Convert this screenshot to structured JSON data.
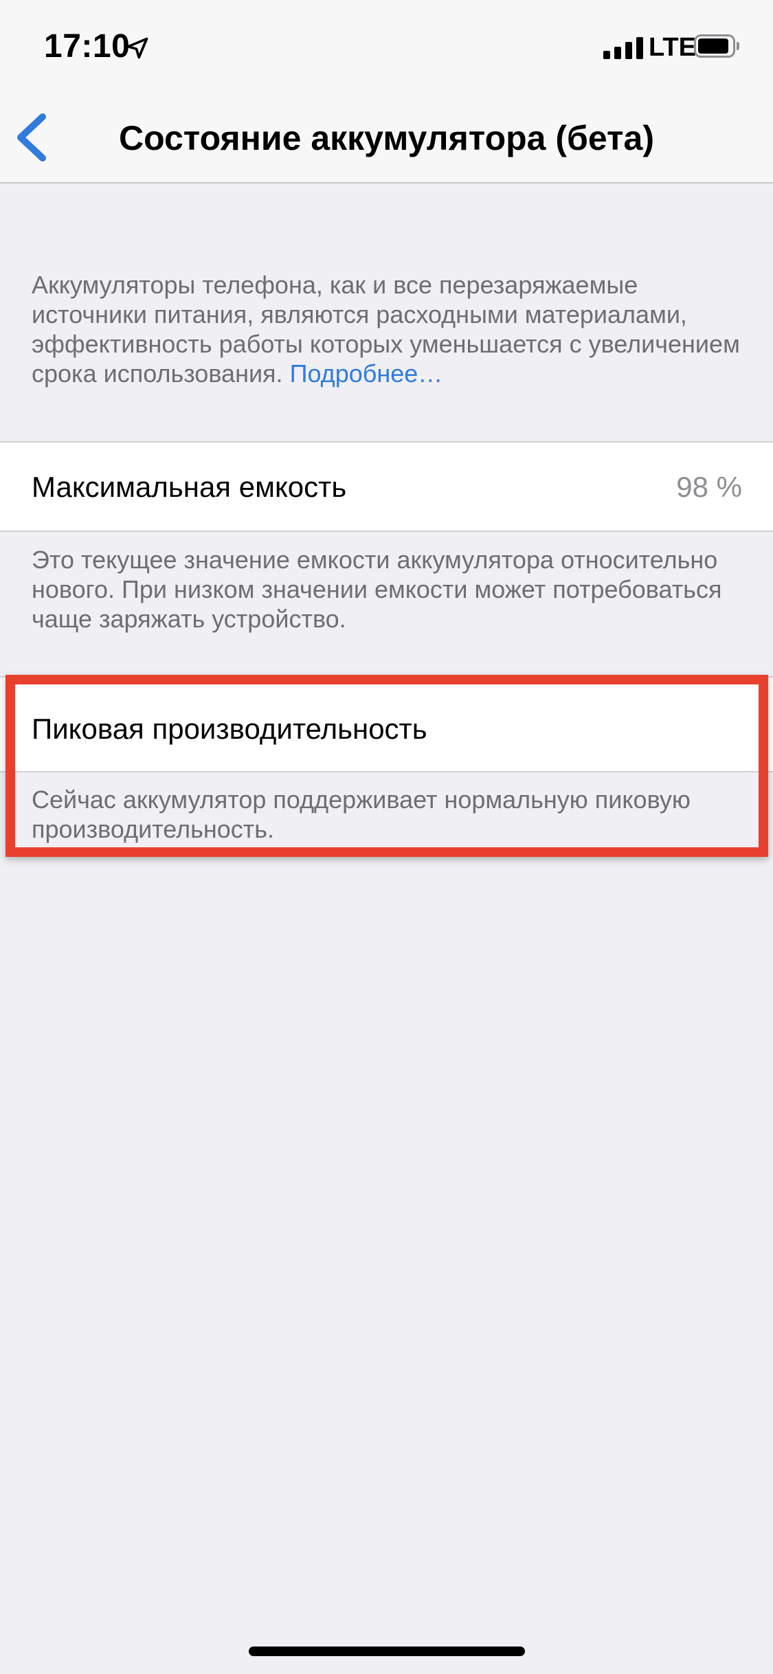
{
  "status_bar": {
    "time": "17:10",
    "network": "LTE",
    "location_icon": "location-arrow-icon",
    "signal_icon": "cellular-signal-icon",
    "battery_icon": "battery-icon"
  },
  "nav": {
    "back_icon": "chevron-left-icon",
    "title": "Состояние аккумулятора (бета)"
  },
  "intro": {
    "text": "Аккумуляторы телефона, как и все перезаряжаемые источники питания, являются расходными материалами, эффективность работы которых уменьшается с увеличением срока использования.",
    "link": "Подробнее…"
  },
  "max_capacity": {
    "label": "Максимальная емкость",
    "value": "98 %",
    "footer": "Это текущее значение емкости аккумулятора относительно нового. При низком значении емкости может потребоваться чаще заряжать устройство."
  },
  "peak_performance": {
    "label": "Пиковая производительность",
    "footer": "Сейчас аккумулятор поддерживает нормальную пиковую производительность."
  },
  "colors": {
    "accent_blue": "#2f7bde",
    "highlight_red": "#e8402d",
    "background": "#efeff4"
  }
}
